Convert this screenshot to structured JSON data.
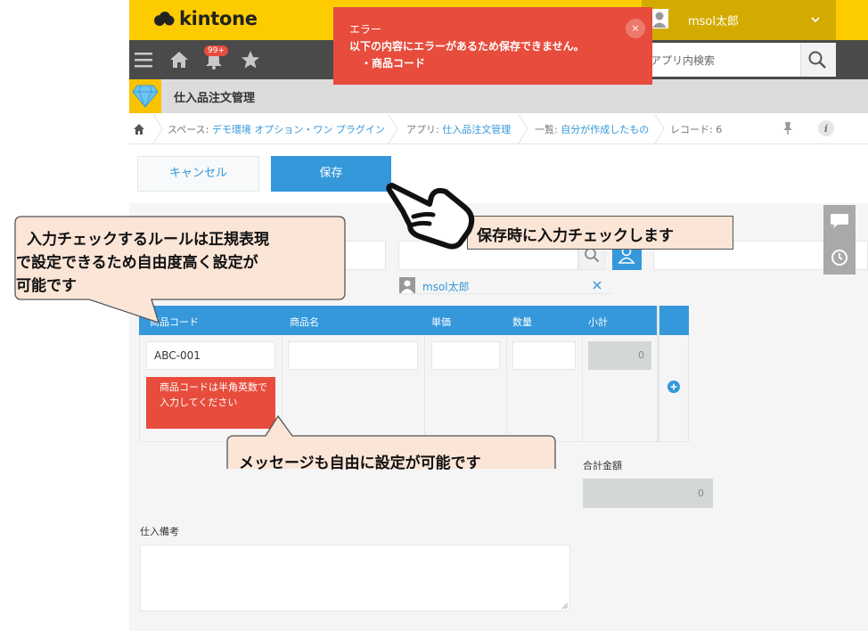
{
  "header": {
    "logo_text": "kintone",
    "user_name": "msol太郎",
    "notification_badge": "99+",
    "search_placeholder": "アプリ内検索"
  },
  "app": {
    "title": "仕入品注文管理"
  },
  "breadcrumb": {
    "space_prefix": "スペース: ",
    "space_name": "デモ環境 オプション・ワン プラグイン",
    "app_prefix": "アプリ: ",
    "app_name": "仕入品注文管理",
    "view_prefix": "一覧: ",
    "view_name": "自分が作成したもの",
    "record": "レコード: 6"
  },
  "toolbar": {
    "cancel_label": "キャンセル",
    "save_label": "保存"
  },
  "error_toast": {
    "title": "エラー",
    "message": "以下の内容にエラーがあるため保存できません。",
    "item": "・商品コード"
  },
  "form": {
    "user_chip": "msol太郎",
    "table": {
      "headers": [
        "商品コード",
        "商品名",
        "単価",
        "数量",
        "小計"
      ],
      "row": {
        "product_code": "ABC-001",
        "product_name": "",
        "unit_price": "",
        "quantity": "",
        "subtotal": "0"
      },
      "error_message": "商品コードは半角英数で入力してください"
    },
    "total_label": "合計金額",
    "total_value": "0",
    "note_label": "仕入備考"
  },
  "callouts": {
    "left": [
      "入力チェックするルールは正規表現",
      "で設定できるため自由度高く設定が",
      "可能です"
    ],
    "right": "保存時に入力チェックします",
    "bottom": "メッセージも自由に設定が可能です"
  },
  "colors": {
    "brand_yellow": "#fccc00",
    "accent_blue": "#3498db",
    "error_red": "#e74c3c",
    "callout_fill": "#fbe5d6"
  },
  "icons": [
    "menu-icon",
    "home-icon",
    "bell-icon",
    "star-icon",
    "search-icon",
    "user-icon",
    "pin-icon",
    "info-icon",
    "add-row-icon",
    "comment-icon",
    "history-icon",
    "pointing-hand-icon"
  ]
}
